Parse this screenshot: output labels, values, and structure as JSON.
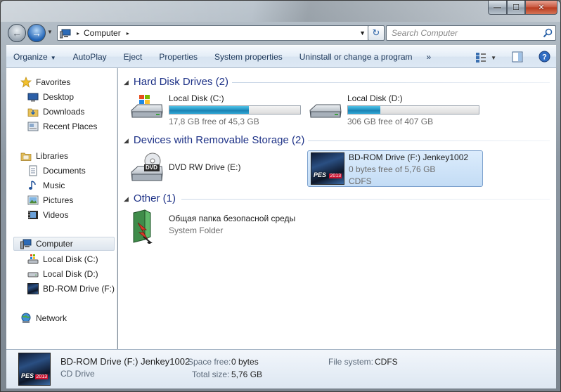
{
  "window": {
    "caption_min": "—",
    "caption_max": "☐",
    "caption_close": "✕"
  },
  "address": {
    "crumb": "Computer",
    "sep": "▸",
    "search_placeholder": "Search Computer"
  },
  "toolbar": {
    "organize": "Organize",
    "autoplay": "AutoPlay",
    "eject": "Eject",
    "properties": "Properties",
    "system_properties": "System properties",
    "uninstall": "Uninstall or change a program",
    "more": "»"
  },
  "nav": {
    "favorites": "Favorites",
    "desktop": "Desktop",
    "downloads": "Downloads",
    "recent": "Recent Places",
    "libraries": "Libraries",
    "documents": "Documents",
    "music": "Music",
    "pictures": "Pictures",
    "videos": "Videos",
    "computer": "Computer",
    "local_c": "Local Disk (C:)",
    "local_d": "Local Disk (D:)",
    "bdrom": "BD-ROM Drive (F:) Jenkey1002",
    "network": "Network"
  },
  "groups": {
    "hdd": "Hard Disk Drives (2)",
    "removable": "Devices with Removable Storage (2)",
    "other": "Other (1)"
  },
  "drives": {
    "c": {
      "name": "Local Disk (C:)",
      "free": "17,8 GB free of 45,3 GB",
      "used_fraction": 0.607
    },
    "d": {
      "name": "Local Disk (D:)",
      "free": "306 GB free of 407 GB",
      "used_fraction": 0.248
    },
    "e": {
      "name": "DVD RW Drive (E:)",
      "badge": "DVD"
    },
    "f": {
      "name": "BD-ROM Drive (F:) Jenkey1002",
      "free": "0 bytes free of 5,76 GB",
      "fs": "CDFS"
    },
    "other": {
      "name": "Общая папка безопасной среды",
      "type": "System Folder"
    }
  },
  "details": {
    "title": "BD-ROM Drive (F:) Jenkey1002",
    "subtitle": "CD Drive",
    "space_free_label": "Space free:",
    "space_free": "0 bytes",
    "total_size_label": "Total size:",
    "total_size": "5,76 GB",
    "fs_label": "File system:",
    "fs": "CDFS",
    "thumb_logo": "PES",
    "thumb_year": "2013"
  },
  "colors": {
    "accent": "#1e3287",
    "bar_fill": "#2597c6",
    "selection": "#c3dcf5"
  }
}
